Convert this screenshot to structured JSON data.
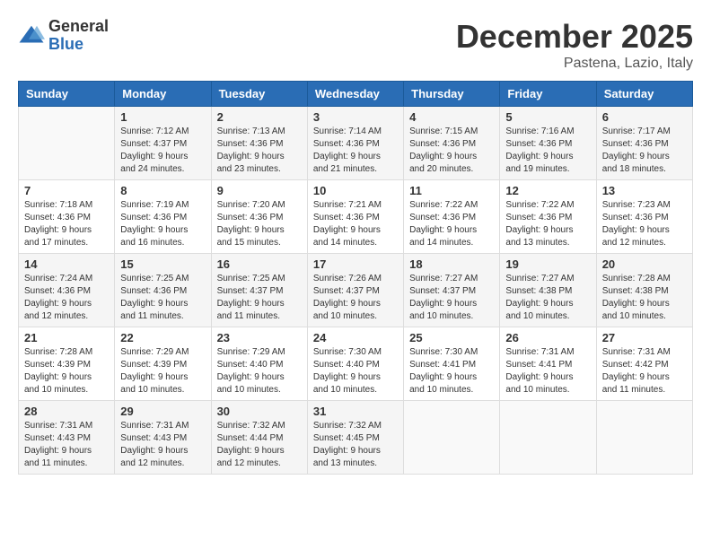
{
  "header": {
    "logo_general": "General",
    "logo_blue": "Blue",
    "month_title": "December 2025",
    "location": "Pastena, Lazio, Italy"
  },
  "weekdays": [
    "Sunday",
    "Monday",
    "Tuesday",
    "Wednesday",
    "Thursday",
    "Friday",
    "Saturday"
  ],
  "weeks": [
    [
      {
        "day": "",
        "info": ""
      },
      {
        "day": "1",
        "info": "Sunrise: 7:12 AM\nSunset: 4:37 PM\nDaylight: 9 hours\nand 24 minutes."
      },
      {
        "day": "2",
        "info": "Sunrise: 7:13 AM\nSunset: 4:36 PM\nDaylight: 9 hours\nand 23 minutes."
      },
      {
        "day": "3",
        "info": "Sunrise: 7:14 AM\nSunset: 4:36 PM\nDaylight: 9 hours\nand 21 minutes."
      },
      {
        "day": "4",
        "info": "Sunrise: 7:15 AM\nSunset: 4:36 PM\nDaylight: 9 hours\nand 20 minutes."
      },
      {
        "day": "5",
        "info": "Sunrise: 7:16 AM\nSunset: 4:36 PM\nDaylight: 9 hours\nand 19 minutes."
      },
      {
        "day": "6",
        "info": "Sunrise: 7:17 AM\nSunset: 4:36 PM\nDaylight: 9 hours\nand 18 minutes."
      }
    ],
    [
      {
        "day": "7",
        "info": "Sunrise: 7:18 AM\nSunset: 4:36 PM\nDaylight: 9 hours\nand 17 minutes."
      },
      {
        "day": "8",
        "info": "Sunrise: 7:19 AM\nSunset: 4:36 PM\nDaylight: 9 hours\nand 16 minutes."
      },
      {
        "day": "9",
        "info": "Sunrise: 7:20 AM\nSunset: 4:36 PM\nDaylight: 9 hours\nand 15 minutes."
      },
      {
        "day": "10",
        "info": "Sunrise: 7:21 AM\nSunset: 4:36 PM\nDaylight: 9 hours\nand 14 minutes."
      },
      {
        "day": "11",
        "info": "Sunrise: 7:22 AM\nSunset: 4:36 PM\nDaylight: 9 hours\nand 14 minutes."
      },
      {
        "day": "12",
        "info": "Sunrise: 7:22 AM\nSunset: 4:36 PM\nDaylight: 9 hours\nand 13 minutes."
      },
      {
        "day": "13",
        "info": "Sunrise: 7:23 AM\nSunset: 4:36 PM\nDaylight: 9 hours\nand 12 minutes."
      }
    ],
    [
      {
        "day": "14",
        "info": "Sunrise: 7:24 AM\nSunset: 4:36 PM\nDaylight: 9 hours\nand 12 minutes."
      },
      {
        "day": "15",
        "info": "Sunrise: 7:25 AM\nSunset: 4:36 PM\nDaylight: 9 hours\nand 11 minutes."
      },
      {
        "day": "16",
        "info": "Sunrise: 7:25 AM\nSunset: 4:37 PM\nDaylight: 9 hours\nand 11 minutes."
      },
      {
        "day": "17",
        "info": "Sunrise: 7:26 AM\nSunset: 4:37 PM\nDaylight: 9 hours\nand 10 minutes."
      },
      {
        "day": "18",
        "info": "Sunrise: 7:27 AM\nSunset: 4:37 PM\nDaylight: 9 hours\nand 10 minutes."
      },
      {
        "day": "19",
        "info": "Sunrise: 7:27 AM\nSunset: 4:38 PM\nDaylight: 9 hours\nand 10 minutes."
      },
      {
        "day": "20",
        "info": "Sunrise: 7:28 AM\nSunset: 4:38 PM\nDaylight: 9 hours\nand 10 minutes."
      }
    ],
    [
      {
        "day": "21",
        "info": "Sunrise: 7:28 AM\nSunset: 4:39 PM\nDaylight: 9 hours\nand 10 minutes."
      },
      {
        "day": "22",
        "info": "Sunrise: 7:29 AM\nSunset: 4:39 PM\nDaylight: 9 hours\nand 10 minutes."
      },
      {
        "day": "23",
        "info": "Sunrise: 7:29 AM\nSunset: 4:40 PM\nDaylight: 9 hours\nand 10 minutes."
      },
      {
        "day": "24",
        "info": "Sunrise: 7:30 AM\nSunset: 4:40 PM\nDaylight: 9 hours\nand 10 minutes."
      },
      {
        "day": "25",
        "info": "Sunrise: 7:30 AM\nSunset: 4:41 PM\nDaylight: 9 hours\nand 10 minutes."
      },
      {
        "day": "26",
        "info": "Sunrise: 7:31 AM\nSunset: 4:41 PM\nDaylight: 9 hours\nand 10 minutes."
      },
      {
        "day": "27",
        "info": "Sunrise: 7:31 AM\nSunset: 4:42 PM\nDaylight: 9 hours\nand 11 minutes."
      }
    ],
    [
      {
        "day": "28",
        "info": "Sunrise: 7:31 AM\nSunset: 4:43 PM\nDaylight: 9 hours\nand 11 minutes."
      },
      {
        "day": "29",
        "info": "Sunrise: 7:31 AM\nSunset: 4:43 PM\nDaylight: 9 hours\nand 12 minutes."
      },
      {
        "day": "30",
        "info": "Sunrise: 7:32 AM\nSunset: 4:44 PM\nDaylight: 9 hours\nand 12 minutes."
      },
      {
        "day": "31",
        "info": "Sunrise: 7:32 AM\nSunset: 4:45 PM\nDaylight: 9 hours\nand 13 minutes."
      },
      {
        "day": "",
        "info": ""
      },
      {
        "day": "",
        "info": ""
      },
      {
        "day": "",
        "info": ""
      }
    ]
  ]
}
